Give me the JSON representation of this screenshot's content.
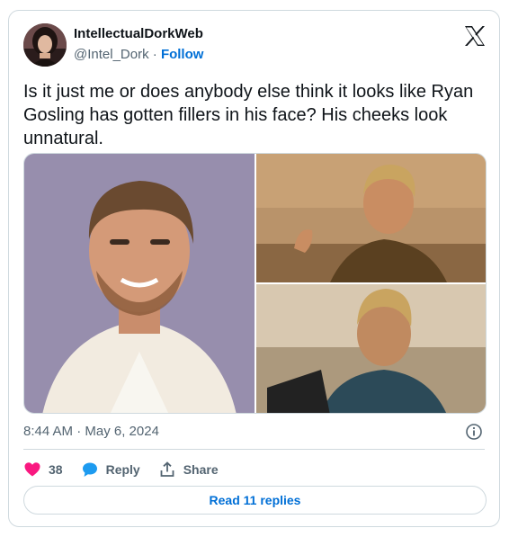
{
  "author": {
    "display_name": "IntellectualDorkWeb",
    "handle": "@Intel_Dork",
    "separator": "·",
    "follow_label": "Follow"
  },
  "tweet": {
    "text": "Is it just me or does anybody else think it looks like Ryan Gosling has gotten fillers in his face? His cheeks look unnatural.",
    "timestamp": "8:44 AM · May 6, 2024"
  },
  "actions": {
    "like_count": "38",
    "reply_label": "Reply",
    "share_label": "Share"
  },
  "read_replies_label": "Read 11 replies",
  "colors": {
    "like": "#f91880",
    "reply": "#1d9bf0",
    "link": "#006fd6",
    "muted": "#536471",
    "border": "#cfd9de"
  },
  "icons": [
    "x-logo-icon",
    "info-icon",
    "heart-icon",
    "reply-bubble-icon",
    "share-icon"
  ]
}
